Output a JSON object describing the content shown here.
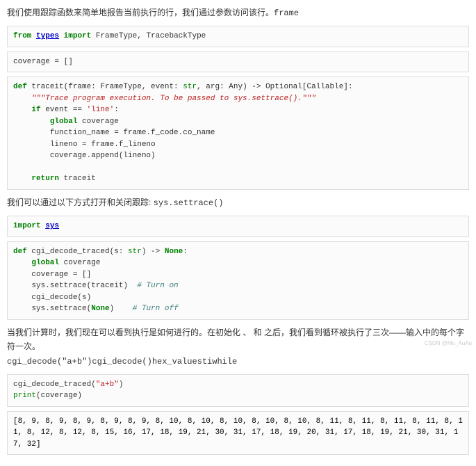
{
  "para1": {
    "prefix": "我们使用跟踪函数来简单地报告当前执行的行，我们通过参数访问该行。",
    "mono": "frame"
  },
  "code1": {
    "from": "from",
    "types": "types",
    "import": "import",
    "names": " FrameType, TracebackType"
  },
  "code2": {
    "line": "coverage = []"
  },
  "code3": {
    "l1_def": "def",
    "l1_sig": " traceit(frame: FrameType, event: ",
    "l1_str": "str",
    "l1_mid": ", arg: Any) -> Optional[Callable]:",
    "l2_doc": "    \"\"\"Trace program execution. To be passed to sys.settrace().\"\"\"",
    "l3_if": "    if",
    "l3_mid": " event == ",
    "l3_lit": "'line'",
    "l3_col": ":",
    "l4_glob": "        global",
    "l4_rest": " coverage",
    "l5": "        function_name = frame.f_code.co_name",
    "l6": "        lineno = frame.f_lineno",
    "l7": "        coverage.append(lineno)",
    "blank": "",
    "l8_ret": "    return",
    "l8_rest": " traceit"
  },
  "para2": {
    "prefix": "我们可以通过以下方式打开和关闭跟踪: ",
    "mono": "sys.settrace()"
  },
  "code4": {
    "import": "import",
    "sys": "sys"
  },
  "code5": {
    "l1_def": "def",
    "l1_sig": " cgi_decode_traced(s: ",
    "l1_str": "str",
    "l1_arrow": ") -> ",
    "l1_none": "None",
    "l1_col": ":",
    "l2_glob": "    global",
    "l2_rest": " coverage",
    "l3": "    coverage = []",
    "l4a": "    sys.settrace(traceit)  ",
    "l4c": "# Turn on",
    "l5": "    cgi_decode(s)",
    "l6a": "    sys.settrace(",
    "l6_none": "None",
    "l6b": ")    ",
    "l6c": "# Turn off"
  },
  "para3": {
    "prefix": "当我们计算时，我们现在可以看到执行是如何进行的。在初始化 、 和 之后，我们看到循环被执行了三次——输入中的每个字符一次。",
    "mono": "cgi_decode(\"a+b\")cgi_decode()hex_valuestiwhile"
  },
  "code6": {
    "l1a": "cgi_decode_traced(",
    "l1s": "\"a+b\"",
    "l1b": ")",
    "l2_p": "print",
    "l2a": "(coverage)"
  },
  "code7": {
    "out": "[8, 9, 8, 9, 8, 9, 8, 9, 8, 9, 8, 10, 8, 10, 8, 10, 8, 10, 8, 10, 8, 11, 8, 11, 8, 11, 8, 11, 8, 11, 8, 12, 8, 12, 8, 15, 16, 17, 18, 19, 21, 30, 31, 17, 18, 19, 20, 31, 17, 18, 19, 21, 30, 31, 17, 32]"
  },
  "watermark": "CSDN @Mu_AuAu"
}
